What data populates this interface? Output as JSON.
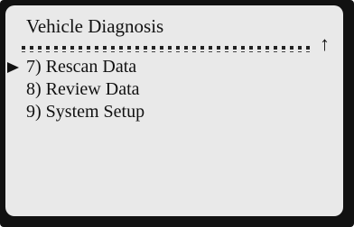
{
  "screen": {
    "title": "Vehicle Diagnosis",
    "scroll_indicator_icon": "up-arrow-icon",
    "selection_pointer_icon": "right-triangle-icon",
    "menu": {
      "items": [
        {
          "label": "7) Rescan Data",
          "selected": true
        },
        {
          "label": "8) Review Data",
          "selected": false
        },
        {
          "label": "9) System Setup",
          "selected": false
        }
      ]
    }
  },
  "colors": {
    "bezel": "#111111",
    "screen_background": "#e9e9e9",
    "text": "#111111"
  }
}
